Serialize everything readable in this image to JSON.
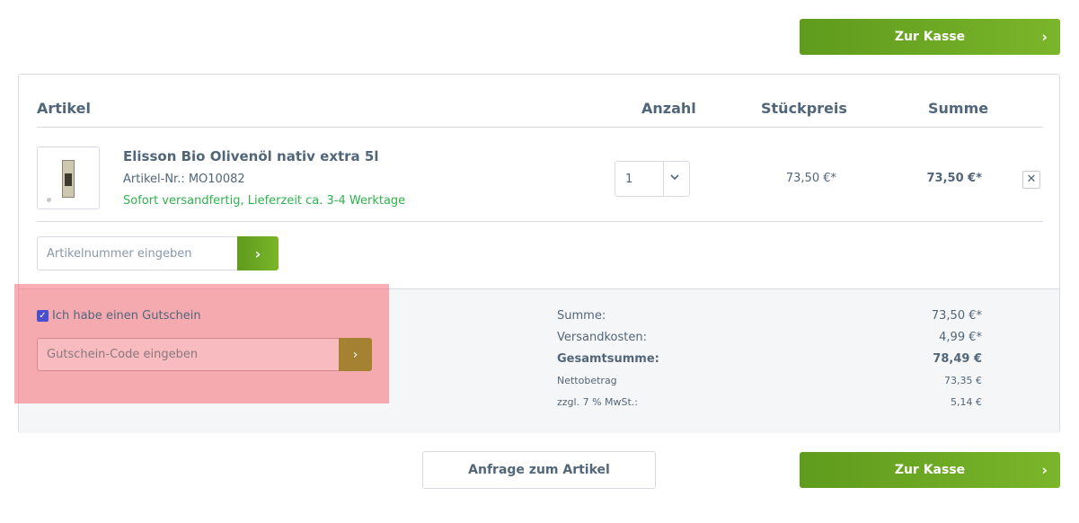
{
  "actions": {
    "checkout_label": "Zur Kasse",
    "request_label": "Anfrage zum Artikel",
    "chevron": "›"
  },
  "table": {
    "headers": {
      "article": "Artikel",
      "quantity": "Anzahl",
      "unit_price": "Stückpreis",
      "total": "Summe"
    }
  },
  "cart_item": {
    "name": "Elisson Bio Olivenöl nativ extra 5l",
    "article_number": "Artikel-Nr.: MO10082",
    "delivery": "Sofort versandfertig, Lieferzeit ca. 3-4 Werktage",
    "quantity": "1",
    "unit_price": "73,50 €*",
    "total": "73,50 €*",
    "remove_symbol": "✕"
  },
  "add_article": {
    "placeholder": "Artikelnummer eingeben",
    "button_symbol": "›"
  },
  "voucher": {
    "checked": true,
    "label": "Ich habe einen Gutschein",
    "placeholder": "Gutschein-Code eingeben",
    "button_symbol": "›"
  },
  "summary": {
    "sum_label": "Summe:",
    "sum_value": "73,50 €*",
    "shipping_label": "Versandkosten:",
    "shipping_value": "4,99 €*",
    "grand_total_label": "Gesamtsumme:",
    "grand_total_value": "78,49 €",
    "net_label": "Nettobetrag",
    "net_value": "73,35 €",
    "vat_label": "zzgl. 7 % MwSt.:",
    "vat_value": "5,14 €"
  },
  "colors": {
    "primary_green": "#6ea824",
    "delivery_green": "#2fb24c",
    "text": "#52667a",
    "border": "#dadae5",
    "highlight": "#f5646e"
  }
}
